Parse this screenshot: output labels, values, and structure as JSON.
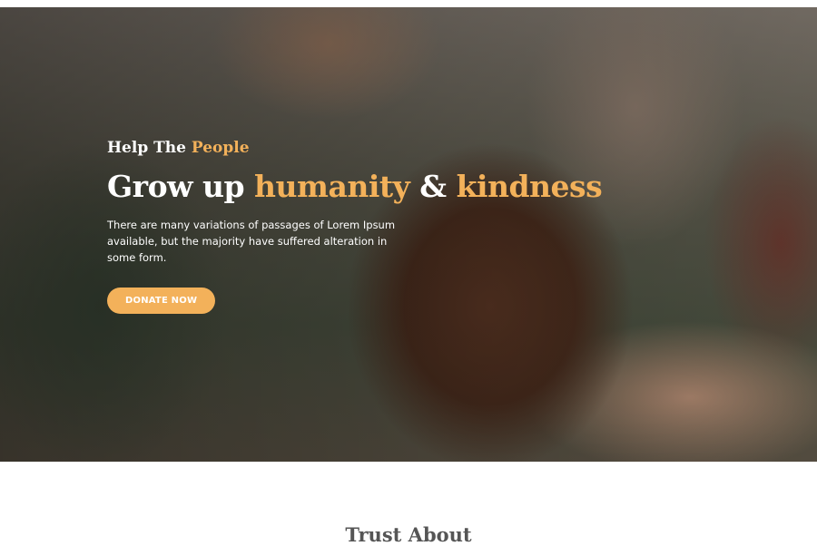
{
  "hero": {
    "eyebrow_prefix": "Help The",
    "eyebrow_accent": "People",
    "headline_part1": "Grow up",
    "headline_accent1": "humanity",
    "headline_part2": "&",
    "headline_accent2": "kindness",
    "description": "There are many variations of passages of Lorem Ipsum available, but the majority have suffered alteration in some form.",
    "button_label": "DONATE NOW"
  },
  "section": {
    "title": "Trust About"
  },
  "colors": {
    "accent": "#f3b15a",
    "heading_dark": "#555555"
  }
}
